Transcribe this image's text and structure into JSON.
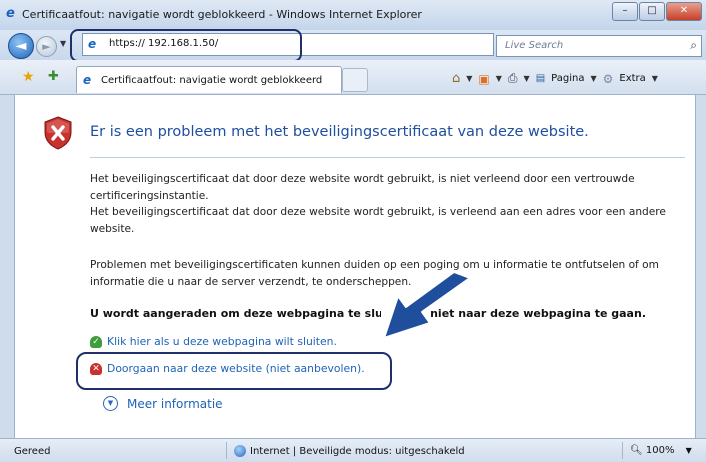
{
  "window": {
    "title": "Certificaatfout: navigatie wordt geblokkeerd - Windows Internet Explorer",
    "buttons": {
      "minimize": "–",
      "maximize": "□",
      "close": "✕"
    }
  },
  "nav": {
    "back_glyph": "◄",
    "forward_glyph": "►",
    "address": "https:// 192.168.1.50/",
    "search_placeholder": "Live Search",
    "refresh_glyph": "↺",
    "stop_glyph": "✕"
  },
  "tab": {
    "label": "Certificaatfout: navigatie wordt geblokkeerd"
  },
  "toolbar": {
    "page": "Pagina",
    "extra": "Extra"
  },
  "page": {
    "heading": "Er is een probleem met het beveiligingscertificaat van deze website.",
    "paragraph1": [
      "Het beveiligingscertificaat dat door deze website wordt gebruikt, is niet verleend door een vertrouwde certificeringsinstantie.",
      "Het beveiligingscertificaat dat door deze website wordt gebruikt, is verleend aan een adres voor een andere website."
    ],
    "paragraph2": "Problemen met beveiligingscertificaten kunnen duiden op een poging om u informatie te ontfutselen of om informatie die u naar de server verzendt, te onderscheppen.",
    "warning": "U wordt aangeraden om deze webpagina te sluiten en niet naar deze webpagina te gaan.",
    "close_link": "Klik hier als u deze webpagina wilt sluiten.",
    "continue_link": "Doorgaan naar deze website (niet aanbevolen).",
    "more_info": "Meer informatie"
  },
  "status": {
    "ready": "Gereed",
    "zone": "Internet | Beveiligde modus: uitgeschakeld",
    "zoom": "100%"
  },
  "colors": {
    "heading": "#1f4fa0",
    "link": "#1e63b7",
    "highlight": "#1e2f6a",
    "shield": "#c8312d"
  }
}
